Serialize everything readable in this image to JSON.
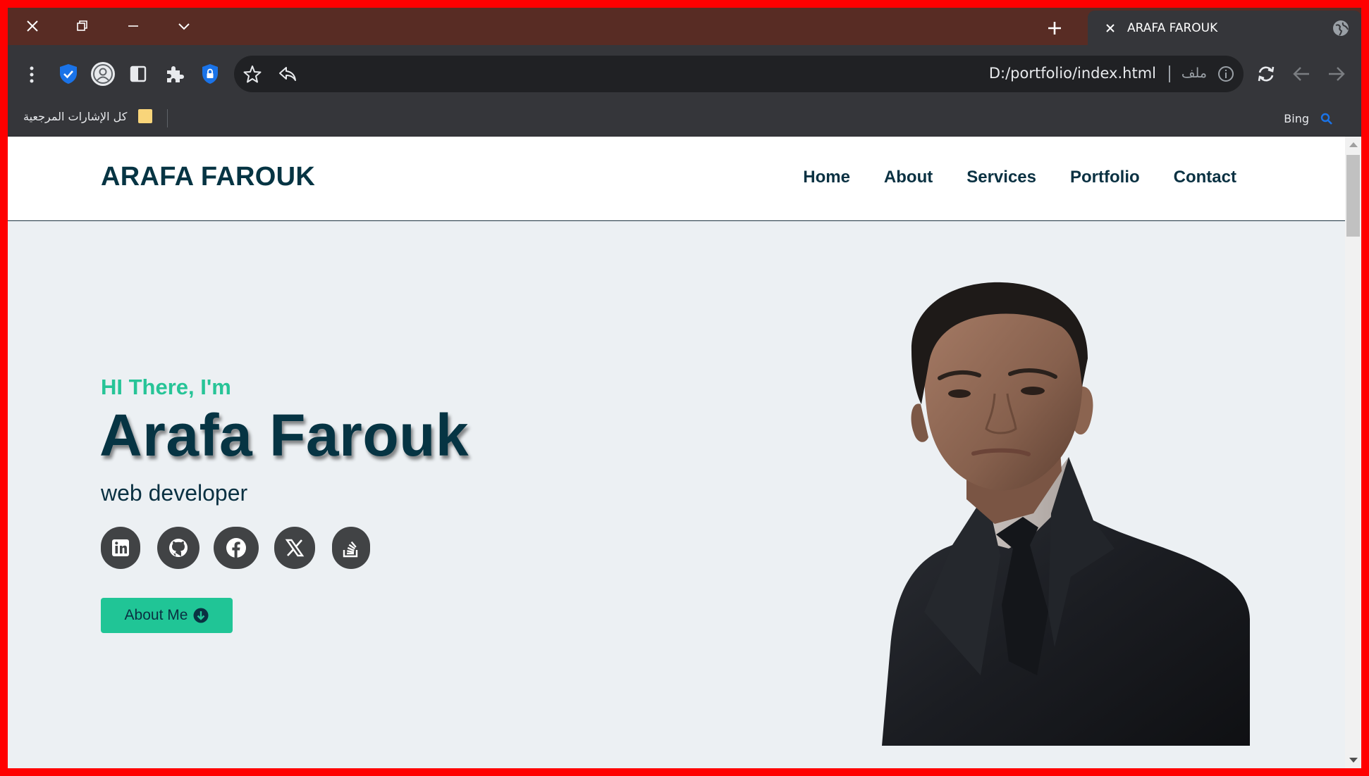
{
  "browser": {
    "tab_title": "ARAFA FAROUK",
    "url": "D:/portfolio/index.html",
    "url_protocol_label": "ملف",
    "bookmarks": {
      "all_bookmarks_label": "كل الإشارات المرجعية",
      "bing_label": "Bing"
    },
    "icons": {
      "window_close": "close-icon",
      "restore": "restore-icon",
      "minimize": "minimize-icon",
      "tab_search": "chevron-down-icon",
      "new_tab": "plus-icon",
      "menu": "more-vert-icon",
      "shield": "shield-check-icon",
      "profile": "profile-icon",
      "sidepanel": "side-panel-icon",
      "extensions": "puzzle-icon",
      "password": "password-shield-icon",
      "bookmark_star": "star-icon",
      "share": "share-icon",
      "site_info": "info-icon",
      "reload": "reload-icon",
      "back": "arrow-left-icon",
      "forward": "arrow-right-icon"
    }
  },
  "site": {
    "logo": "ARAFA FAROUK",
    "nav": [
      "Home",
      "About",
      "Services",
      "Portfolio",
      "Contact"
    ],
    "hero": {
      "greeting": "HI There, I'm",
      "name": "Arafa Farouk",
      "role": "web developer",
      "socials": [
        "linkedin-icon",
        "github-icon",
        "facebook-icon",
        "x-twitter-icon",
        "stackoverflow-icon"
      ],
      "cta_label": "About Me"
    },
    "colors": {
      "primary_dark": "#063443",
      "accent": "#20c596",
      "background": "#ecf0f3",
      "tabstrip": "#582c24",
      "frame": "#ff0000"
    }
  }
}
